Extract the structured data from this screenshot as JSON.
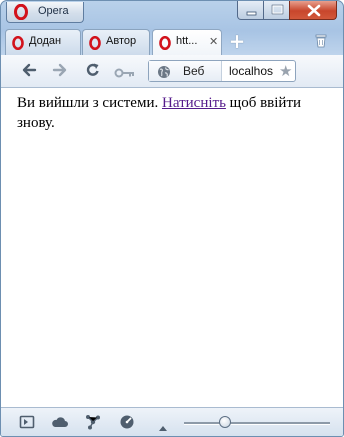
{
  "window": {
    "app_button_label": "Opera"
  },
  "tabs": [
    {
      "label": "Додан",
      "active": false
    },
    {
      "label": "Автор",
      "active": false
    },
    {
      "label": "htt...",
      "active": true,
      "close_glyph": "✕"
    }
  ],
  "tabstrip": {
    "new_tab_glyph": "+",
    "trash_icon": "trash-icon"
  },
  "toolbar": {
    "back_icon": "back-arrow-icon",
    "forward_icon": "forward-arrow-icon",
    "reload_icon": "reload-icon",
    "key_icon": "key-icon",
    "address": {
      "badge_label": "Веб",
      "url": "localhos",
      "star_glyph": "★"
    }
  },
  "content": {
    "text_before": "Ви вийшли з системи. ",
    "link_text": "Натисніть",
    "text_after": " щоб ввійти знову."
  },
  "statusbar": {
    "icons": [
      "panel-icon",
      "cloud-icon",
      "unite-icon",
      "speed-dial-icon",
      "up-arrow-icon"
    ],
    "zoom_level_fraction": 0.28
  },
  "colors": {
    "link": "#551a8b",
    "chrome_blue": "#b9d1ea",
    "close_red": "#c8462c"
  }
}
